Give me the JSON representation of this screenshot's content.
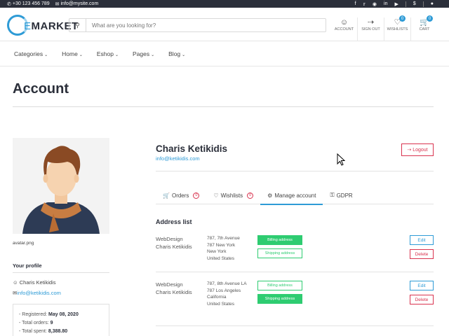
{
  "topbar": {
    "phone": "+30 123 456 789",
    "email": "info@mysite.com",
    "currency": "$"
  },
  "header": {
    "logo_letter": "E",
    "logo_text": "MARKET",
    "search_placeholder": "What are you looking for?",
    "icons": [
      {
        "label": "ACCOUNT",
        "glyph": "user-icon"
      },
      {
        "label": "SIGN OUT",
        "glyph": "sign-out-icon"
      },
      {
        "label": "WISHLISTS",
        "glyph": "heart-icon",
        "badge": "0"
      },
      {
        "label": "CART",
        "glyph": "cart-icon",
        "badge": "0"
      }
    ]
  },
  "nav": {
    "items": [
      "Categories",
      "Home",
      "Eshop",
      "Pages",
      "Blog"
    ]
  },
  "page": {
    "title": "Account"
  },
  "profile": {
    "avatar_caption": "avatar.png",
    "heading": "Your profile",
    "name": "Charis Ketikidis",
    "email": "info@ketikidis.com",
    "stats": [
      {
        "label": "- Registered:",
        "value": "May 08, 2020"
      },
      {
        "label": "- Total orders:",
        "value": "9"
      },
      {
        "label": "- Total spent:",
        "value": "8,388.80"
      }
    ]
  },
  "account": {
    "name": "Charis Ketikidis",
    "email": "info@ketikidis.com",
    "logout_label": "Logout",
    "tabs": [
      {
        "label": "Orders",
        "count": "0"
      },
      {
        "label": "Wishlists",
        "count": "0"
      },
      {
        "label": "Manage account"
      },
      {
        "label": "GDPR"
      }
    ],
    "address_title": "Address list",
    "addresses": [
      {
        "company": "WebDesign",
        "person": "Charis Ketikidis",
        "lines": [
          "787, 7th Avenue",
          "787 New York",
          "New York",
          "United States"
        ],
        "tags": [
          "Billing address",
          "Shipping address"
        ],
        "edit_label": "Edit",
        "delete_label": "Delete"
      },
      {
        "company": "WebDesign",
        "person": "Charis Ketikidis",
        "lines": [
          "787, 8th Avenue LA",
          "787 Los Angeles",
          "California",
          "United States"
        ],
        "tags": [
          "Billing address",
          "Shipping address"
        ],
        "edit_label": "Edit",
        "delete_label": "Delete"
      }
    ]
  },
  "colors": {
    "accent": "#2e9bd6",
    "danger": "#d9334f",
    "success": "#2ecc71",
    "dark": "#2b2f3a"
  }
}
